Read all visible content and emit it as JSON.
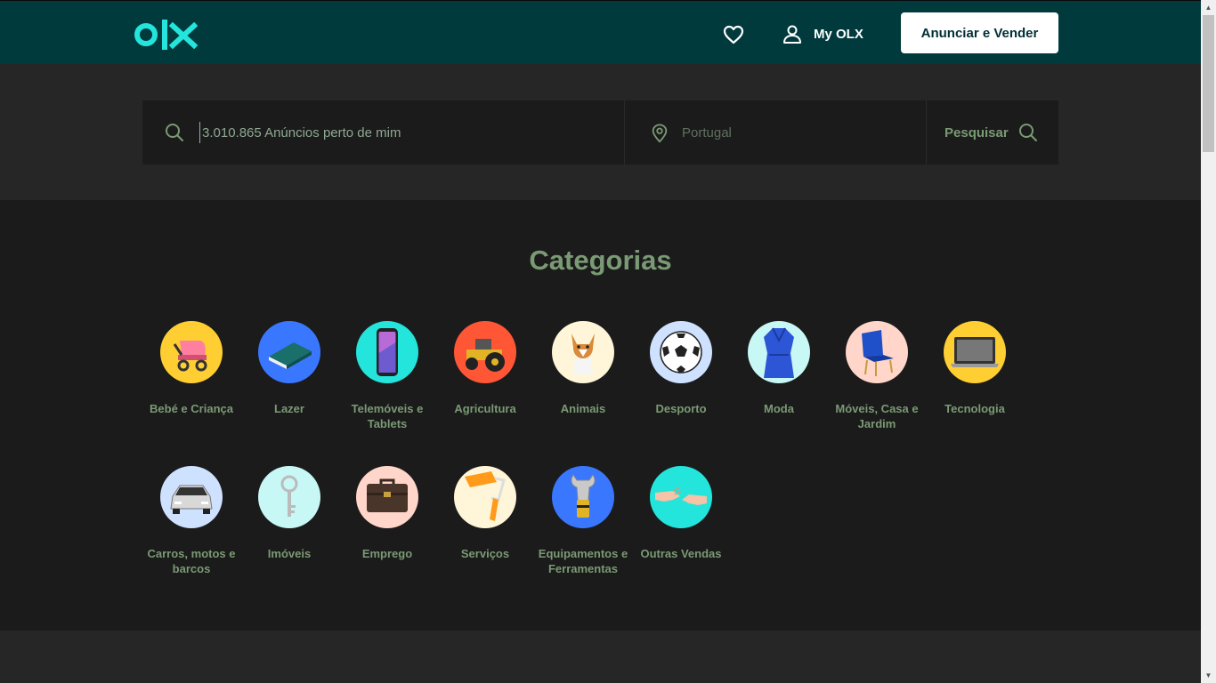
{
  "header": {
    "logo_text": "olx",
    "my_account_label": "My OLX",
    "post_button_label": "Anunciar e Vender"
  },
  "search": {
    "query_placeholder": "3.010.865 Anúncios perto de mim",
    "location_placeholder": "Portugal",
    "button_label": "Pesquisar"
  },
  "categories": {
    "title": "Categorias",
    "items": [
      {
        "label": "Bebé e Criança",
        "icon": "stroller-icon",
        "color": "#ffce32"
      },
      {
        "label": "Lazer",
        "icon": "book-icon",
        "color": "#3a77ff"
      },
      {
        "label": "Telemóveis e Tablets",
        "icon": "smartphone-icon",
        "color": "#23e5db"
      },
      {
        "label": "Agricultura",
        "icon": "tractor-icon",
        "color": "#ff5636"
      },
      {
        "label": "Animais",
        "icon": "dog-icon",
        "color": "#fff6d9"
      },
      {
        "label": "Desporto",
        "icon": "football-icon",
        "color": "#cee1ff"
      },
      {
        "label": "Moda",
        "icon": "robe-icon",
        "color": "#c8f8f6"
      },
      {
        "label": "Móveis, Casa e Jardim",
        "icon": "armchair-icon",
        "color": "#ffd6c9"
      },
      {
        "label": "Tecnologia",
        "icon": "laptop-icon",
        "color": "#ffce32"
      },
      {
        "label": "Carros, motos e barcos",
        "icon": "car-icon",
        "color": "#cee1ff"
      },
      {
        "label": "Imóveis",
        "icon": "key-icon",
        "color": "#c8f8f6"
      },
      {
        "label": "Emprego",
        "icon": "briefcase-icon",
        "color": "#ffd6c9"
      },
      {
        "label": "Serviços",
        "icon": "paint-roller-icon",
        "color": "#fff6d9"
      },
      {
        "label": "Equipamentos e Ferramentas",
        "icon": "wrench-icon",
        "color": "#3a77ff"
      },
      {
        "label": "Outras Vendas",
        "icon": "handshake-icon",
        "color": "#23e5db"
      }
    ]
  },
  "colors": {
    "header_bg": "#003a3d",
    "brand_teal": "#23e5db",
    "accent_green": "#7a9a74"
  }
}
